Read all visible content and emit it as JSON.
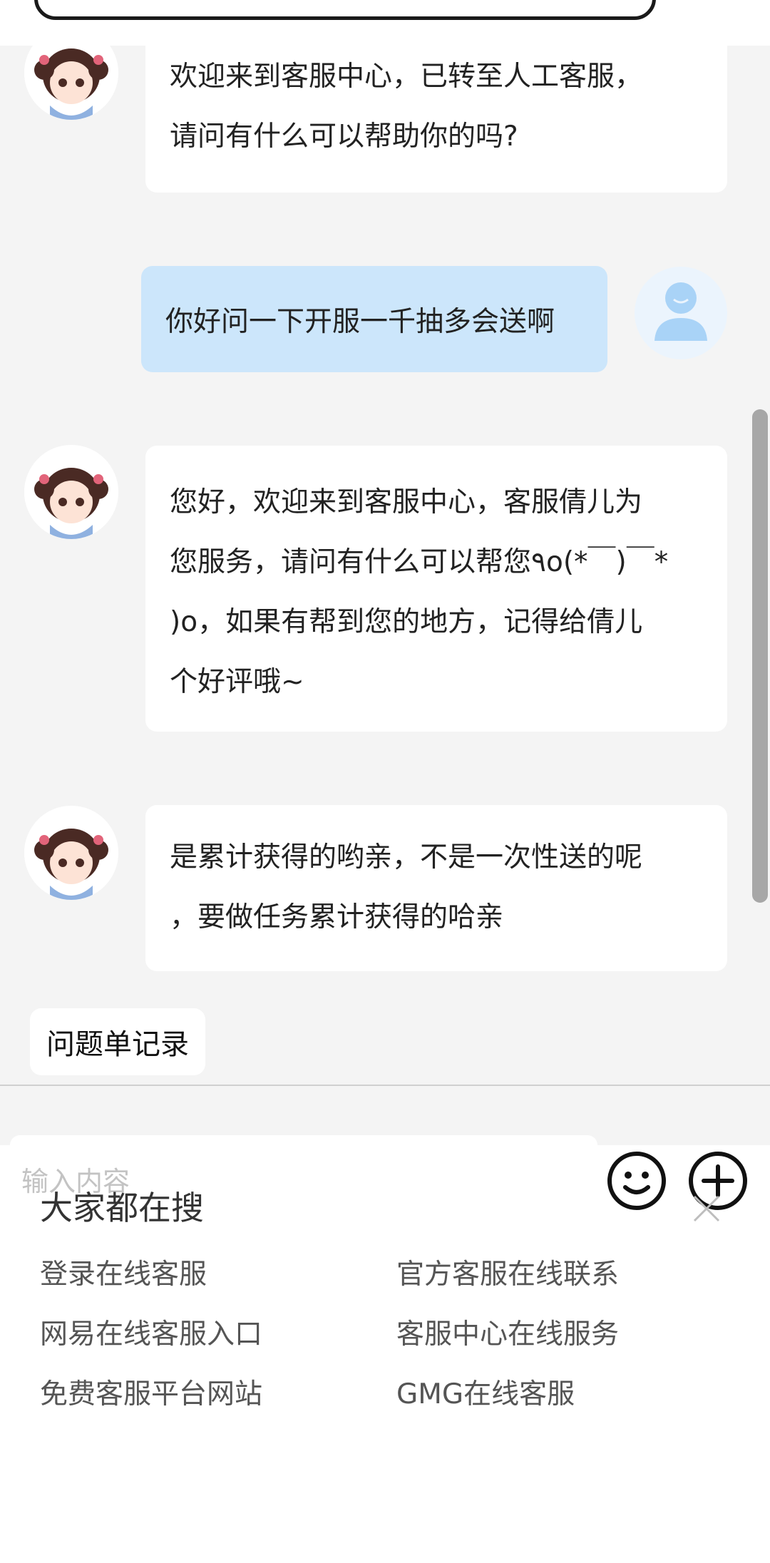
{
  "top_bar": {
    "search_label": ""
  },
  "messages": [
    {
      "from": "agent",
      "text": "欢迎来到客服中心，已转至人工客服，\n请问有什么可以帮助你的吗?"
    },
    {
      "from": "user",
      "text": "你好问一下开服一千抽多会送啊"
    },
    {
      "from": "agent",
      "text": "您好，欢迎来到客服中心，客服倩儿为\n您服务，请问有什么可以帮您٩o(*￣)￣*\n)o，如果有帮到您的地方，记得给倩儿\n个好评哦~"
    },
    {
      "from": "agent",
      "text": "是累计获得的哟亲，不是一次性送的呢\n，要做任务累计获得的哈亲"
    }
  ],
  "ticket_record": {
    "label": "问题单记录"
  },
  "input": {
    "placeholder": "输入内容",
    "emoji_icon": "emoji-icon",
    "plus_icon": "plus-circle-icon"
  },
  "suggestions": {
    "title": "大家都在搜",
    "items": [
      "登录在线客服",
      "官方客服在线联系",
      "网易在线客服入口",
      "客服中心在线服务",
      "免费客服平台网站",
      "GMG在线客服"
    ]
  },
  "colors": {
    "background": "#f4f4f4",
    "agent_bubble": "#ffffff",
    "user_bubble": "#cce6fb",
    "user_avatar_bg": "#ebf4fd",
    "user_avatar_fg": "#a9d3f7"
  }
}
